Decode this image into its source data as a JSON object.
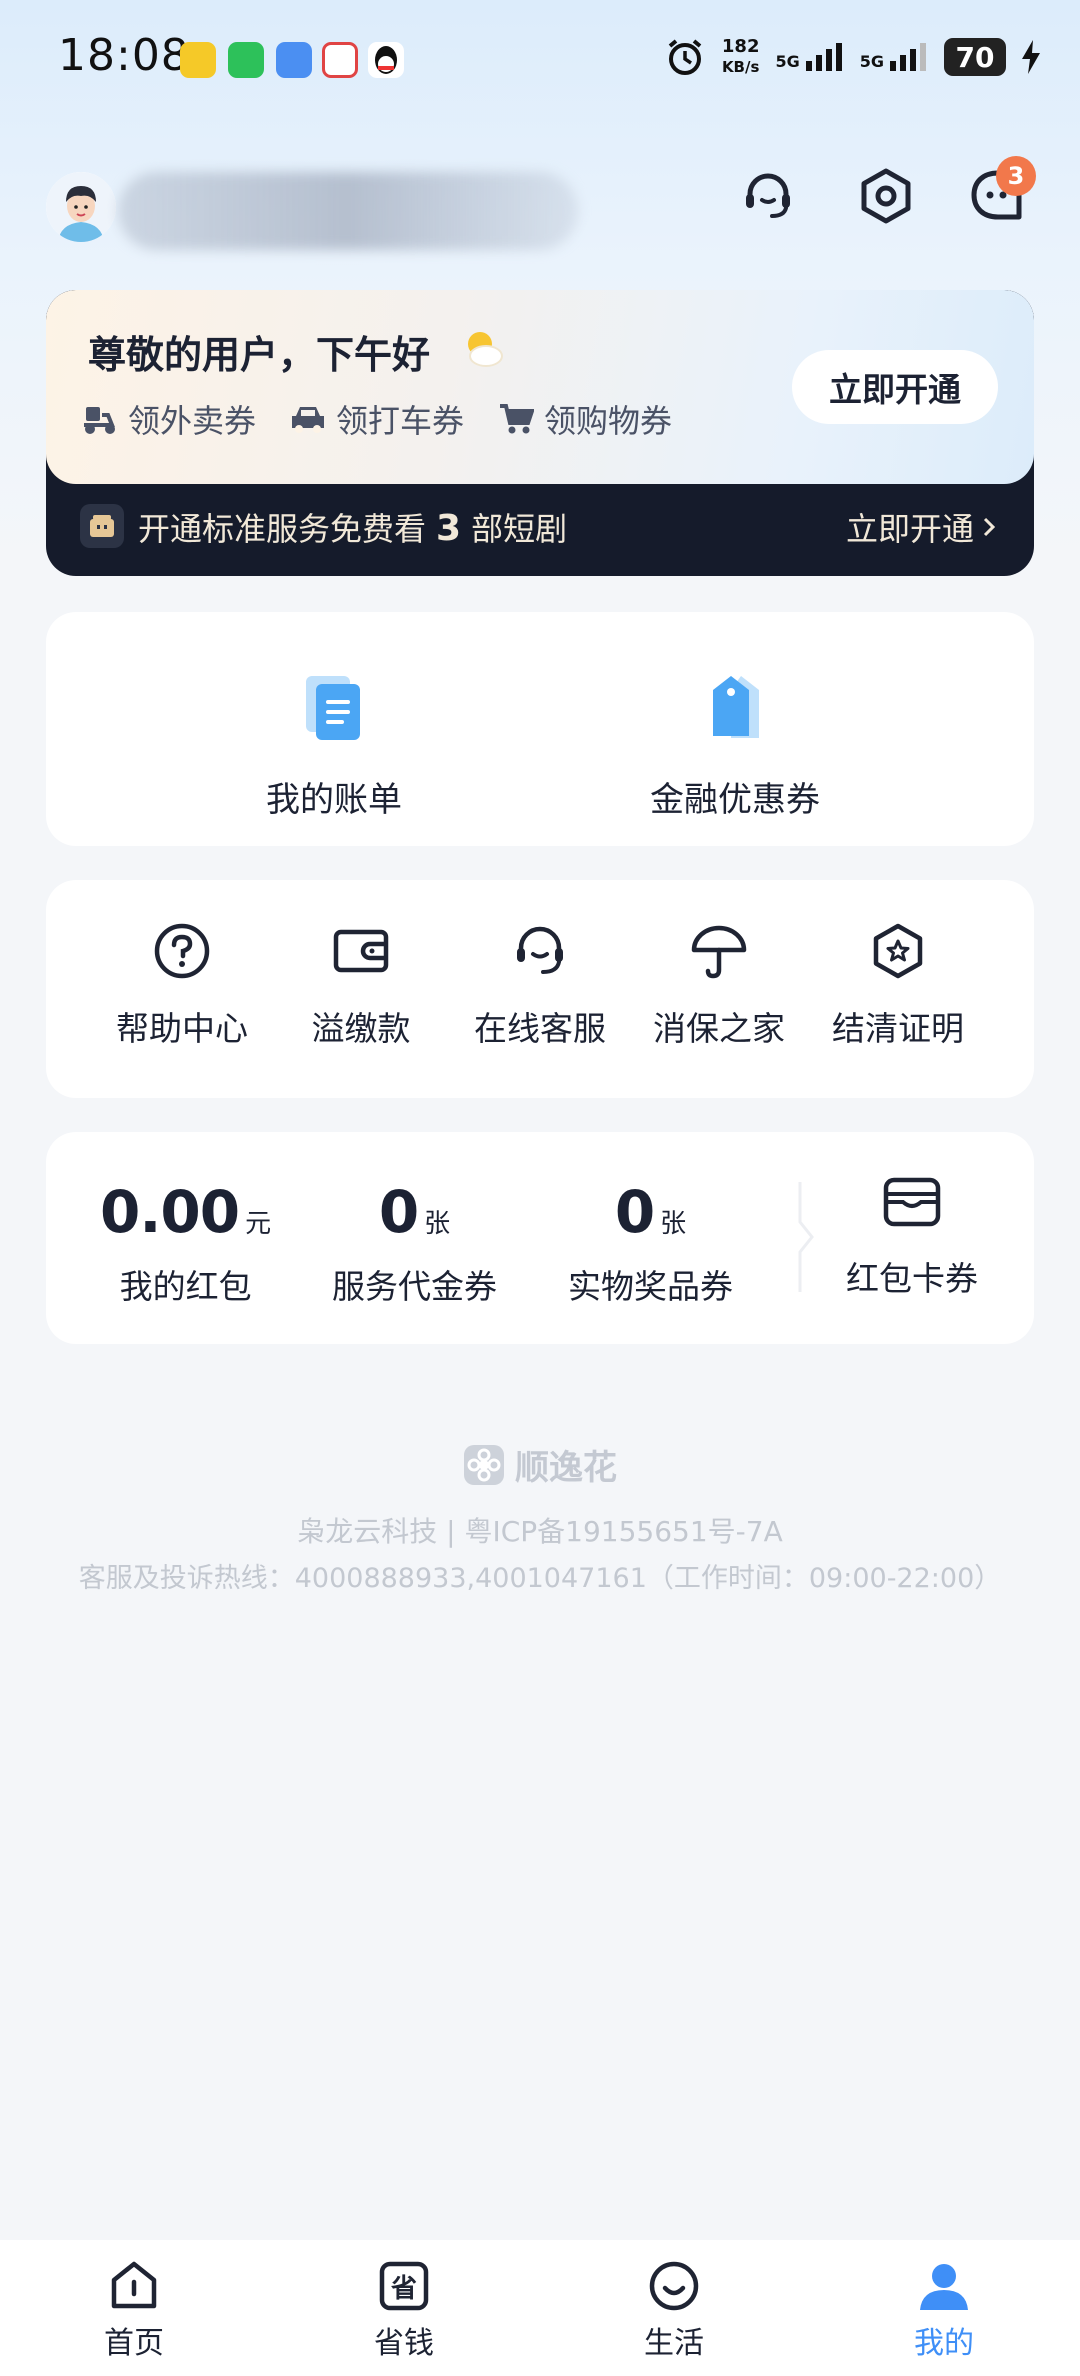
{
  "status_bar": {
    "time": "18:08",
    "speed_value": "182",
    "speed_unit": "KB/s",
    "net1": "5G",
    "net2": "5G",
    "battery": "70"
  },
  "header": {
    "notification_count": "3"
  },
  "promo": {
    "greeting": "尊敬的用户，下午好",
    "coupons": [
      "领外卖券",
      "领打车券",
      "领购物券"
    ],
    "open_button": "立即开通",
    "banner_text_pre": "开通标准服务免费看",
    "banner_text_num": "3",
    "banner_text_post": "部短剧",
    "banner_link": "立即开通"
  },
  "bills": {
    "items": [
      "我的账单",
      "金融优惠券"
    ]
  },
  "services": {
    "items": [
      "帮助中心",
      "溢缴款",
      "在线客服",
      "消保之家",
      "结清证明"
    ]
  },
  "stats": {
    "red_packet": {
      "value": "0.00",
      "unit": "元",
      "label": "我的红包"
    },
    "service_voucher": {
      "value": "0",
      "unit": "张",
      "label": "服务代金券"
    },
    "prize_voucher": {
      "value": "0",
      "unit": "张",
      "label": "实物奖品券"
    },
    "card_wallet": {
      "label": "红包卡券"
    }
  },
  "footer": {
    "brand": "顺逸花",
    "company": "枭龙云科技 | 粤ICP备19155651号-7A",
    "hotline": "客服及投诉热线：4000888933,4001047161（工作时间：09:00-22:00）"
  },
  "tabbar": {
    "tabs": [
      "首页",
      "省钱",
      "生活",
      "我的"
    ]
  },
  "colors": {
    "accent": "#3f8ff7",
    "badge": "#f2784b",
    "dark_banner": "#151b2b"
  }
}
